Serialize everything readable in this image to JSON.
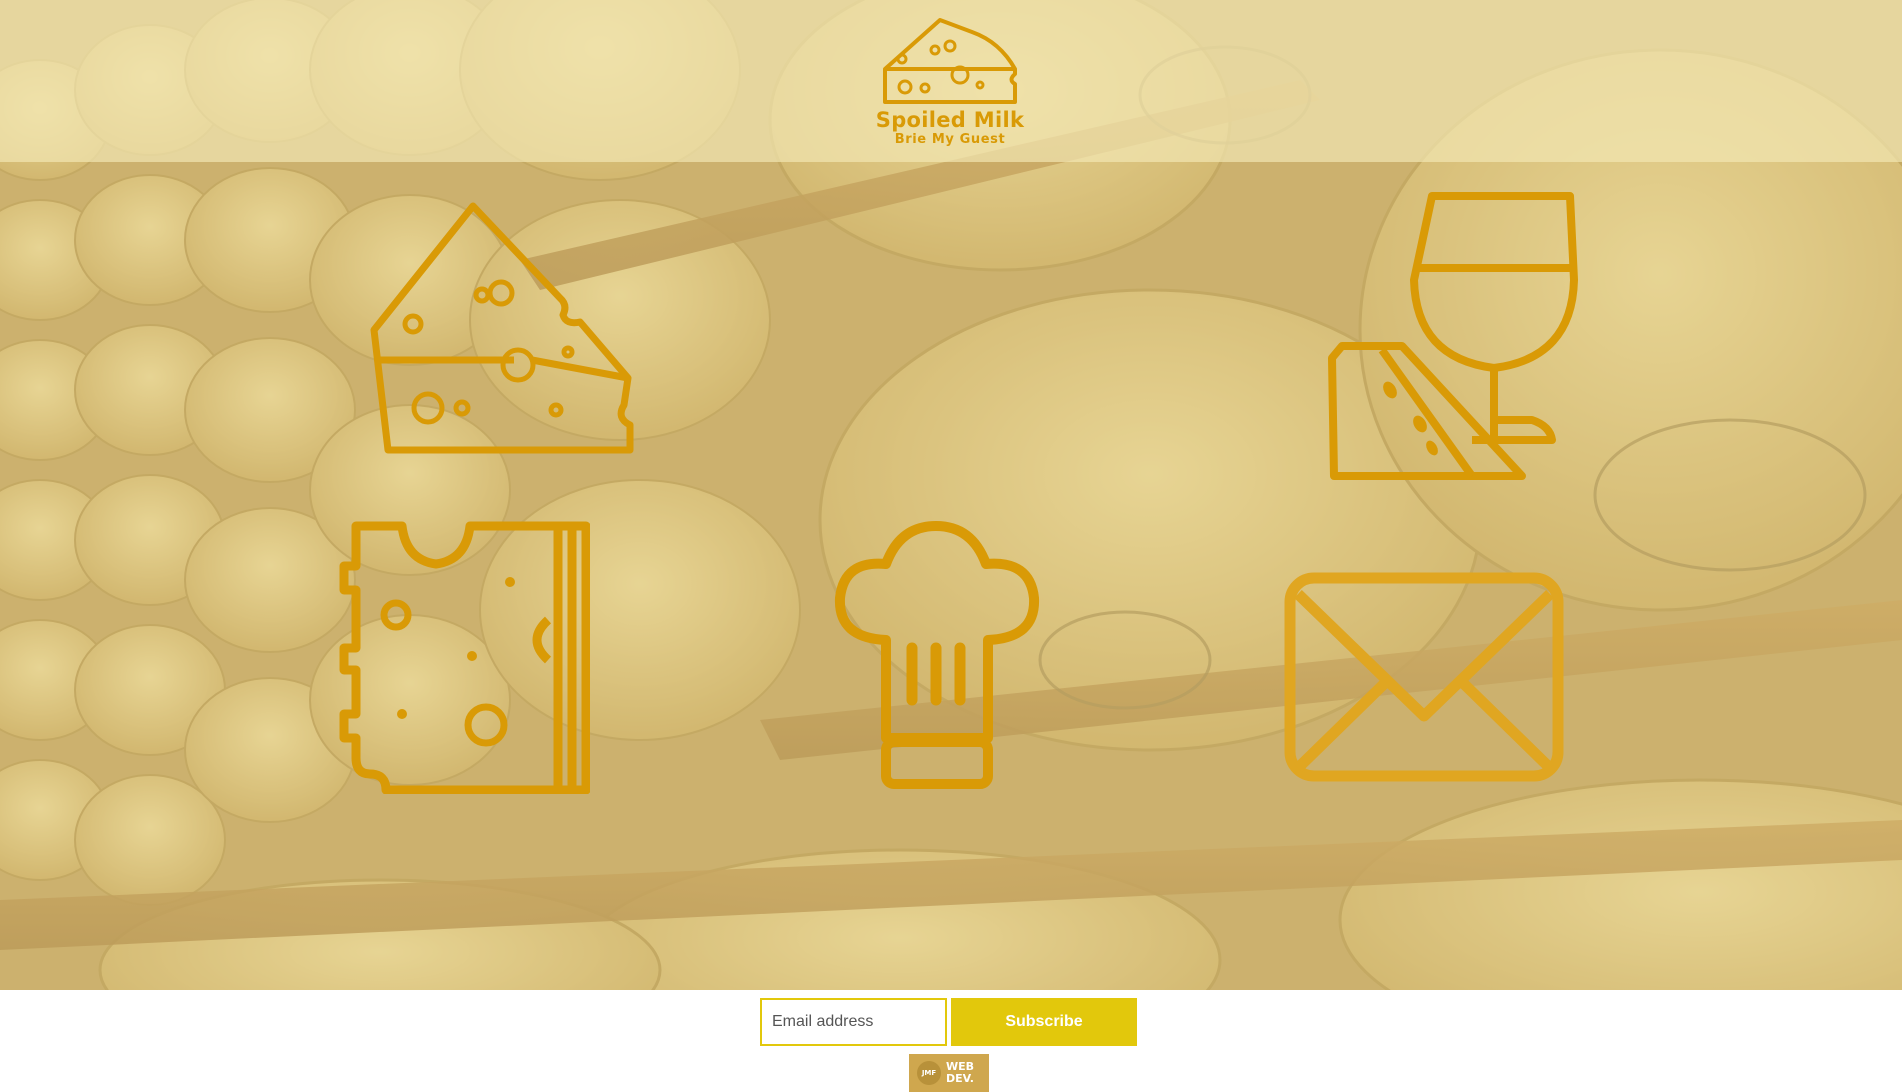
{
  "brand": {
    "name": "Spoiled Milk",
    "tagline": "Brie My Guest"
  },
  "features": [
    {
      "icon": "cheese-wedge-icon"
    },
    {
      "icon": "wine-and-cheese-icon"
    },
    {
      "icon": "cheese-block-icon"
    },
    {
      "icon": "chef-hat-icon"
    },
    {
      "icon": "envelope-icon"
    }
  ],
  "newsletter": {
    "email_placeholder": "Email address",
    "email_value": "",
    "subscribe_label": "Subscribe"
  },
  "badge": {
    "mark": "JMF",
    "text": "WEB\nDEV."
  },
  "colors": {
    "accent": "#d99a06",
    "button": "#e2c80c",
    "header_band": "#eee0aa",
    "badge": "#cfa74e"
  }
}
